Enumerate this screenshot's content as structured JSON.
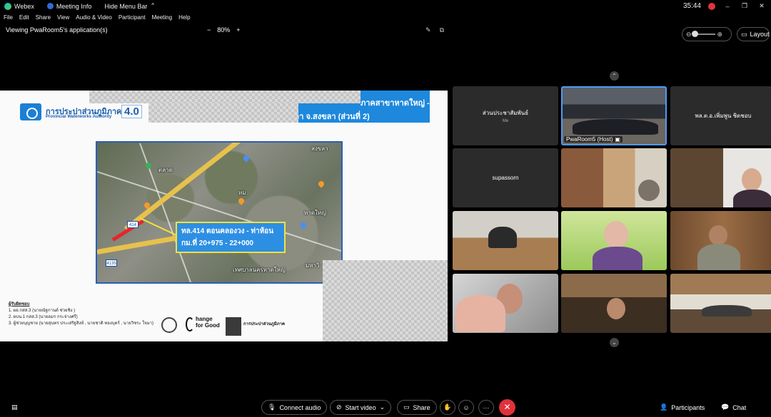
{
  "titlebar": {
    "app_name": "Webex",
    "meeting_info": "Meeting Info",
    "hide_menu_bar": "Hide Menu Bar",
    "timer": "35:44",
    "minimize": "–",
    "restore": "❐",
    "close": "✕"
  },
  "menubar": {
    "items": [
      "File",
      "Edit",
      "Share",
      "View",
      "Audio & Video",
      "Participant",
      "Meeting",
      "Help"
    ]
  },
  "sharebar": {
    "viewing": "Viewing PwaRoom5's application(s)",
    "zoom_out": "−",
    "zoom_level": "80%",
    "zoom_in": "+"
  },
  "right_top": {
    "layout_label": "Layout"
  },
  "slide": {
    "org_th": "การประปาส่วนภูมิภาค",
    "org_en": "Provincial Waterworks Authority",
    "version": "4.0",
    "banner_line1": "ภาคสาขาหาดใหญ่ -",
    "banner_line2": "ขลา จ.สงขลา (ส่วนที่ 2)",
    "route_line1": "ทล.414 ตอนคลองวง - ท่าห้อน",
    "route_line2": "กม.ที่ 20+975 - 22+000",
    "road_shield": "414",
    "road_shield2": "4135",
    "map_labels": [
      "ตลาด",
      "หม",
      "สงขลา",
      "หาดใหญ่",
      "เทศบาลนครหาดใหญ่",
      "มหาวิ"
    ],
    "credits_header": "ผู้รับผิดชอบ",
    "credits": [
      "1. ผอ.กสส.3 (นายณัฐกานต์ ช่วยชิง )",
      "2. ผบน.1 กสส.3 (นายอมร กระจ่างศรี)",
      "3. ผู้ช่วยบุญชาย (นายสุนทร ประเสริฐสิงห์ , นายชาติ ทองบุตร์ , นายวิชระ ใจมา)"
    ],
    "change_for_good": [
      "hange",
      "for Good"
    ],
    "pwa_footer": "การประปาส่วนภูมิภาค"
  },
  "participants": [
    {
      "name": "ส่วนประชาสัมพันธ์",
      "sub": "Me"
    },
    {
      "name": "PwaRoom5 (Host)"
    },
    {
      "name": "พล.ต.อ.เพิ่มพูน ชิดชอบ"
    },
    {
      "name": "supassorn"
    }
  ],
  "controls": {
    "connect_audio": "Connect audio",
    "start_video": "Start video",
    "share": "Share",
    "participants": "Participants",
    "chat": "Chat",
    "more": "···",
    "end": "✕"
  }
}
